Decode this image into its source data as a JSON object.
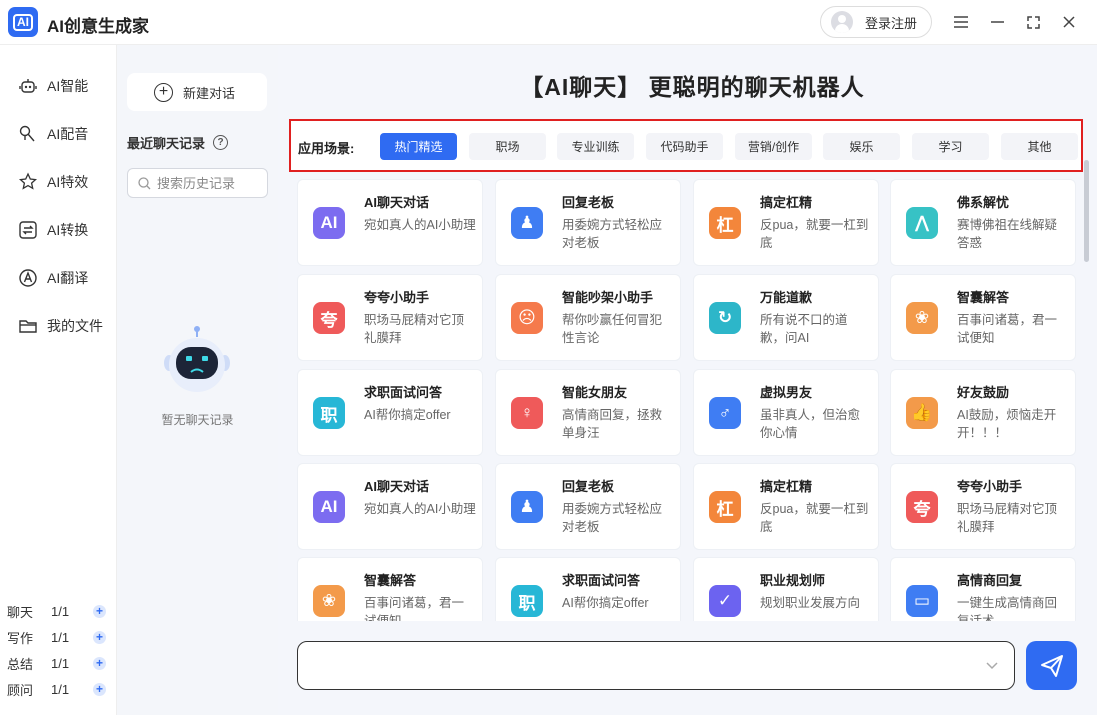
{
  "app": {
    "logo_text": "AI",
    "title": "AI创意生成家",
    "login_label": "登录注册"
  },
  "nav": [
    {
      "label": "AI智能",
      "icon": "robot-icon"
    },
    {
      "label": "AI配音",
      "icon": "microphone-icon"
    },
    {
      "label": "AI特效",
      "icon": "sparkle-star-icon"
    },
    {
      "label": "AI转换",
      "icon": "convert-icon"
    },
    {
      "label": "AI翻译",
      "icon": "translate-icon"
    },
    {
      "label": "我的文件",
      "icon": "folder-icon"
    }
  ],
  "quotas": [
    {
      "label": "聊天",
      "value": "1/1"
    },
    {
      "label": "写作",
      "value": "1/1"
    },
    {
      "label": "总结",
      "value": "1/1"
    },
    {
      "label": "顾问",
      "value": "1/1"
    }
  ],
  "history": {
    "new_chat": "新建对话",
    "recent_title": "最近聊天记录",
    "help": "?",
    "search_placeholder": "搜索历史记录",
    "empty": "暂无聊天记录"
  },
  "main": {
    "headline": "【AI聊天】 更聪明的聊天机器人",
    "scene_label": "应用场景:",
    "tags": [
      "热门精选",
      "职场",
      "专业训练",
      "代码助手",
      "营销/创作",
      "娱乐",
      "学习",
      "其他"
    ],
    "active_tag": "热门精选",
    "input_placeholder": ""
  },
  "cards": [
    {
      "title": "AI聊天对话",
      "desc": "宛如真人的AI小助理",
      "icon_char": "AI",
      "color": "#7c6cf0"
    },
    {
      "title": "回复老板",
      "desc": "用委婉方式轻松应对老板",
      "icon_char": "♟",
      "color": "#3f7df3"
    },
    {
      "title": "搞定杠精",
      "desc": "反pua，就要一杠到底",
      "icon_char": "杠",
      "color": "#f3863b"
    },
    {
      "title": "佛系解忧",
      "desc": "赛博佛祖在线解疑答惑",
      "icon_char": "⋀",
      "color": "#37c2c5"
    },
    {
      "title": "夸夸小助手",
      "desc": "职场马屁精对它顶礼膜拜",
      "icon_char": "夸",
      "color": "#ef5a5a"
    },
    {
      "title": "智能吵架小助手",
      "desc": "帮你吵赢任何冒犯性言论",
      "icon_char": "☹",
      "color": "#f57a4c"
    },
    {
      "title": "万能道歉",
      "desc": "所有说不口的道歉，问AI",
      "icon_char": "↻",
      "color": "#2db6c9"
    },
    {
      "title": "智囊解答",
      "desc": "百事问诸葛，君一试便知",
      "icon_char": "❀",
      "color": "#f39a4a"
    },
    {
      "title": "求职面试问答",
      "desc": "AI帮你搞定offer",
      "icon_char": "职",
      "color": "#27b7d6"
    },
    {
      "title": "智能女朋友",
      "desc": "高情商回复，拯救单身汪",
      "icon_char": "♀",
      "color": "#ef5a5a"
    },
    {
      "title": "虚拟男友",
      "desc": "虽非真人，但治愈你心情",
      "icon_char": "♂",
      "color": "#3f7df3"
    },
    {
      "title": "好友鼓励",
      "desc": "AI鼓励，烦恼走开开！！！",
      "icon_char": "👍",
      "color": "#f39a4a"
    },
    {
      "title": "AI聊天对话",
      "desc": "宛如真人的AI小助理",
      "icon_char": "AI",
      "color": "#7c6cf0"
    },
    {
      "title": "回复老板",
      "desc": "用委婉方式轻松应对老板",
      "icon_char": "♟",
      "color": "#3f7df3"
    },
    {
      "title": "搞定杠精",
      "desc": "反pua，就要一杠到底",
      "icon_char": "杠",
      "color": "#f3863b"
    },
    {
      "title": "夸夸小助手",
      "desc": "职场马屁精对它顶礼膜拜",
      "icon_char": "夸",
      "color": "#ef5a5a"
    },
    {
      "title": "智囊解答",
      "desc": "百事问诸葛，君一试便知",
      "icon_char": "❀",
      "color": "#f39a4a"
    },
    {
      "title": "求职面试问答",
      "desc": "AI帮你搞定offer",
      "icon_char": "职",
      "color": "#27b7d6"
    },
    {
      "title": "职业规划师",
      "desc": "规划职业发展方向",
      "icon_char": "✓",
      "color": "#6c63f0"
    },
    {
      "title": "高情商回复",
      "desc": "一键生成高情商回复话术",
      "icon_char": "▭",
      "color": "#3f7df3"
    }
  ]
}
